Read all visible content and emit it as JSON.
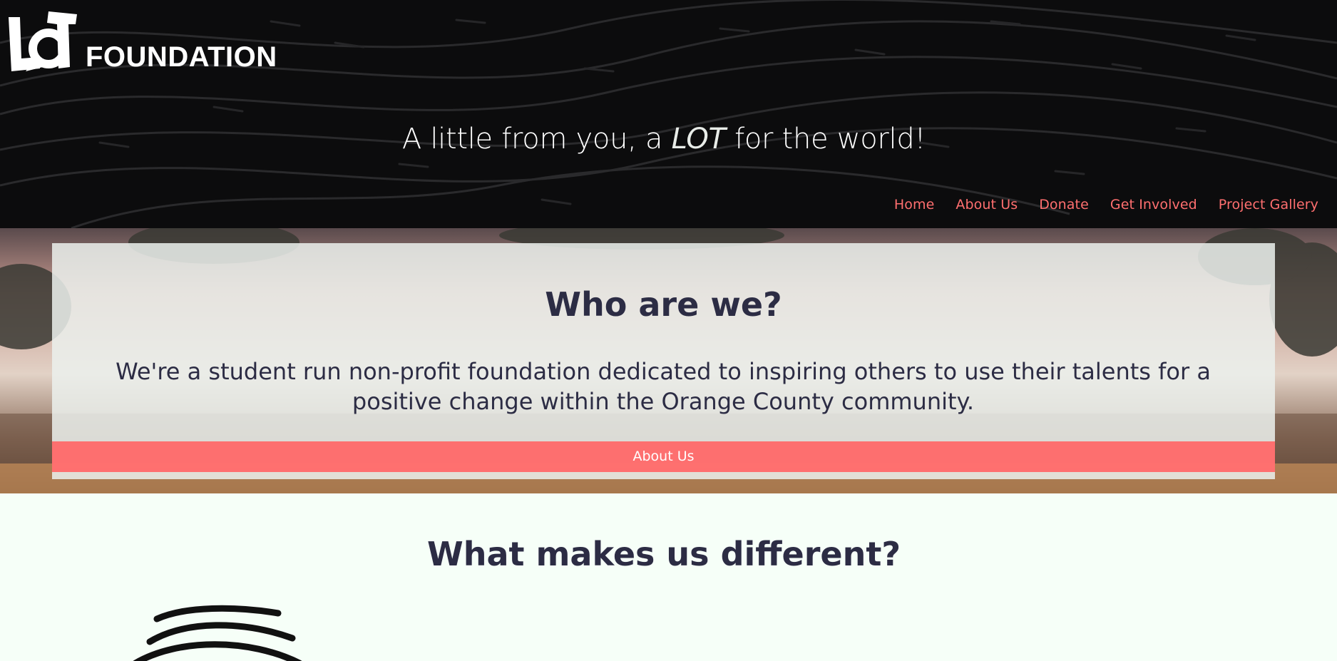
{
  "header": {
    "logo_text": "FOUNDATION",
    "tagline_before": "A little from you, a ",
    "tagline_emphasis": "LOT",
    "tagline_after": " for the world!"
  },
  "nav": {
    "items": [
      {
        "label": "Home"
      },
      {
        "label": "About Us"
      },
      {
        "label": "Donate"
      },
      {
        "label": "Get Involved"
      },
      {
        "label": "Project Gallery"
      }
    ]
  },
  "hero": {
    "title": "Who are we?",
    "description": "We're a student run non-profit foundation dedicated to inspiring others to use their talents for a positive change within the Orange County community.",
    "button_label": "About Us"
  },
  "different": {
    "title": "What makes us different?"
  },
  "colors": {
    "header_bg": "#0c0c0d",
    "accent": "#ff6f6f",
    "text_dark": "#2c2c44",
    "page_bg": "#f6fff8"
  },
  "icons": {
    "logo": "lot-logo-icon",
    "feature": "wavy-lines-icon"
  }
}
